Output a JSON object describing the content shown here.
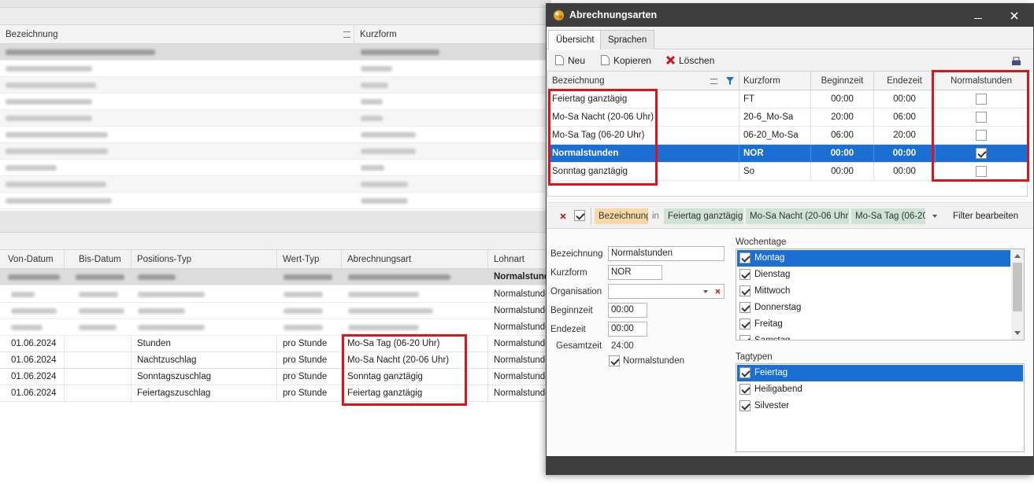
{
  "background": {
    "top_grid": {
      "columns": [
        "Bezeichnung",
        "Kurzform"
      ]
    },
    "bottom_grid": {
      "columns": [
        "Von-Datum",
        "Bis-Datum",
        "Positions-Typ",
        "Wert-Typ",
        "Abrechnungsart",
        "Lohnart"
      ],
      "first_row_lohnart": "Normalstunden",
      "rows_lohnart": [
        "Normalstunden",
        "Normalstunden",
        "Normalstunden"
      ],
      "rows": [
        {
          "von": "01.06.2024",
          "bis": "",
          "typ": "Stunden",
          "wert": "pro Stunde",
          "art": "Mo-Sa Tag (06-20 Uhr)",
          "lohnart": "Normalstunden"
        },
        {
          "von": "01.06.2024",
          "bis": "",
          "typ": "Nachtzuschlag",
          "wert": "pro Stunde",
          "art": "Mo-Sa Nacht (20-06 Uhr)",
          "lohnart": "Normalstunden"
        },
        {
          "von": "01.06.2024",
          "bis": "",
          "typ": "Sonntagszuschlag",
          "wert": "pro Stunde",
          "art": "Sonntag ganztägig",
          "lohnart": "Normalstunden"
        },
        {
          "von": "01.06.2024",
          "bis": "",
          "typ": "Feiertagszuschlag",
          "wert": "pro Stunde",
          "art": "Feiertag ganztägig",
          "lohnart": "Normalstunden"
        }
      ]
    }
  },
  "dialog": {
    "title": "Abrechnungsarten",
    "tabs": [
      "Übersicht",
      "Sprachen"
    ],
    "toolbar": {
      "new": "Neu",
      "copy": "Kopieren",
      "delete": "Löschen"
    },
    "grid": {
      "columns": [
        "Bezeichnung",
        "Kurzform",
        "Beginnzeit",
        "Endezeit",
        "Normalstunden"
      ],
      "rows": [
        {
          "name": "Feiertag ganztägig",
          "short": "FT",
          "begin": "00:00",
          "end": "00:00",
          "normal": false
        },
        {
          "name": "Mo-Sa Nacht (20-06 Uhr)",
          "short": "20-6_Mo-Sa",
          "begin": "20:00",
          "end": "06:00",
          "normal": false
        },
        {
          "name": "Mo-Sa Tag (06-20 Uhr)",
          "short": "06-20_Mo-Sa",
          "begin": "06:00",
          "end": "20:00",
          "normal": false
        },
        {
          "name": "Normalstunden",
          "short": "NOR",
          "begin": "00:00",
          "end": "00:00",
          "normal": true
        },
        {
          "name": "Sonntag ganztägig",
          "short": "So",
          "begin": "00:00",
          "end": "00:00",
          "normal": false
        }
      ],
      "selected_row": 3
    },
    "filter": {
      "field": "Bezeichnung",
      "operator": "in",
      "values": [
        "Feiertag ganztägig",
        "Mo-Sa Nacht (20-06 Uhr)",
        "Mo-Sa Tag (06-20"
      ],
      "edit_label": "Filter bearbeiten"
    },
    "detail": {
      "bezeichnung_label": "Bezeichnung",
      "bezeichnung_value": "Normalstunden",
      "kurzform_label": "Kurzform",
      "kurzform_value": "NOR",
      "organisation_label": "Organisation",
      "organisation_value": "",
      "beginnzeit_label": "Beginnzeit",
      "beginnzeit_value": "00:00",
      "endezeit_label": "Endezeit",
      "endezeit_value": "00:00",
      "gesamtzeit_label": "Gesamtzeit",
      "gesamtzeit_value": "24:00",
      "normalstunden_label": "Normalstunden",
      "normalstunden_checked": true
    },
    "wochentage": {
      "label": "Wochentage",
      "items": [
        {
          "label": "Montag",
          "checked": true
        },
        {
          "label": "Dienstag",
          "checked": true
        },
        {
          "label": "Mittwoch",
          "checked": true
        },
        {
          "label": "Donnerstag",
          "checked": true
        },
        {
          "label": "Freitag",
          "checked": true
        },
        {
          "label": "Samstag",
          "checked": true
        }
      ]
    },
    "tagtypen": {
      "label": "Tagtypen",
      "items": [
        {
          "label": "Feiertag",
          "checked": true
        },
        {
          "label": "Heiligabend",
          "checked": true
        },
        {
          "label": "Silvester",
          "checked": true
        }
      ]
    }
  },
  "colors": {
    "selection": "#1b6fd2",
    "highlight_box": "#d9161c",
    "titlebar": "#3e3e3e",
    "filter_field": "#f8d9a6",
    "filter_value": "#cfe3d4"
  }
}
